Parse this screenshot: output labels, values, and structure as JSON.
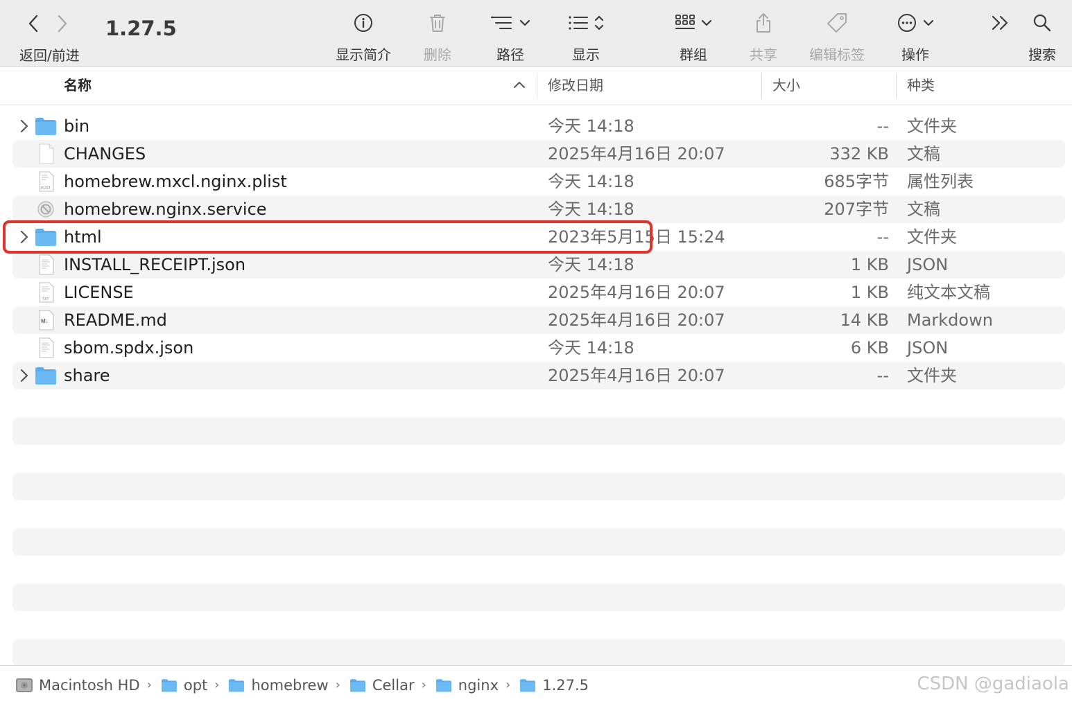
{
  "toolbar": {
    "nav_label": "返回/前进",
    "title": "1.27.5",
    "items": [
      {
        "label": "显示简介",
        "icon": "info-icon"
      },
      {
        "label": "删除",
        "icon": "trash-icon"
      },
      {
        "label": "路径",
        "icon": "path-icon"
      },
      {
        "label": "显示",
        "icon": "list-view-icon"
      },
      {
        "label": "群组",
        "icon": "group-icon"
      },
      {
        "label": "共享",
        "icon": "share-icon"
      },
      {
        "label": "编辑标签",
        "icon": "tag-icon"
      },
      {
        "label": "操作",
        "icon": "action-icon"
      },
      {
        "label": "搜索",
        "icon": "search-icon"
      }
    ]
  },
  "columns": {
    "name": "名称",
    "date": "修改日期",
    "size": "大小",
    "kind": "种类"
  },
  "files": [
    {
      "name": "bin",
      "date": "今天 14:18",
      "size": "--",
      "kind": "文件夹",
      "icon": "folder-icon"
    },
    {
      "name": "CHANGES",
      "date": "2025年4月16日 20:07",
      "size": "332 KB",
      "kind": "文稿",
      "icon": "document-icon"
    },
    {
      "name": "homebrew.mxcl.nginx.plist",
      "date": "今天 14:18",
      "size": "685字节",
      "kind": "属性列表",
      "icon": "plist-icon"
    },
    {
      "name": "homebrew.nginx.service",
      "date": "今天 14:18",
      "size": "207字节",
      "kind": "文稿",
      "icon": "unsupported-file-icon"
    },
    {
      "name": "html",
      "date": "2023年5月15日 15:24",
      "size": "--",
      "kind": "文件夹",
      "icon": "folder-icon"
    },
    {
      "name": "INSTALL_RECEIPT.json",
      "date": "今天 14:18",
      "size": "1 KB",
      "kind": "JSON",
      "icon": "json-file-icon"
    },
    {
      "name": "LICENSE",
      "date": "2025年4月16日 20:07",
      "size": "1 KB",
      "kind": "纯文本文稿",
      "icon": "txt-file-icon"
    },
    {
      "name": "README.md",
      "date": "2025年4月16日 20:07",
      "size": "14 KB",
      "kind": "Markdown",
      "icon": "markdown-file-icon"
    },
    {
      "name": "sbom.spdx.json",
      "date": "今天 14:18",
      "size": "6 KB",
      "kind": "JSON",
      "icon": "json-file-icon"
    },
    {
      "name": "share",
      "date": "2025年4月16日 20:07",
      "size": "--",
      "kind": "文件夹",
      "icon": "folder-icon"
    }
  ],
  "path": [
    "Macintosh HD",
    "opt",
    "homebrew",
    "Cellar",
    "nginx",
    "1.27.5"
  ],
  "watermark": "CSDN @gadiaola",
  "colors": {
    "highlight": "#e0332a",
    "folder": "#5aaef0",
    "stripe": "#f4f4f4"
  }
}
